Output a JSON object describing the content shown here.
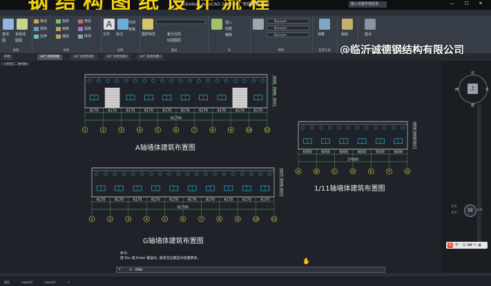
{
  "banner": {
    "title": "钢结构图纸设计流程",
    "window_title": "Autodesk AutoCAD 2022  34厂房结构图.dwg",
    "signin_placeholder": "键入关键字或短语",
    "window_buttons": "— ☐ ✕"
  },
  "watermark": "@临沂诚德钢结构有限公司",
  "ribbon_tabs": [
    "默认",
    "插入",
    "注释",
    "参数化",
    "视图",
    "管理",
    "输出",
    "附加模块",
    "协作",
    "Express Tools",
    "精选应用"
  ],
  "ribbon": {
    "panels": [
      {
        "label": "绘图",
        "tools": [
          "直线",
          "多段线",
          "圆",
          "圆弧"
        ]
      },
      {
        "label": "修改",
        "tools": [
          "移动",
          "旋转",
          "修剪",
          "复制",
          "镜像",
          "圆角",
          "拉伸",
          "缩放",
          "阵列"
        ]
      },
      {
        "label": "注释",
        "tools": [
          "文字",
          "标注",
          "引线",
          "表格"
        ]
      },
      {
        "label": "图层",
        "tools": [
          "图层特性",
          "置为当前",
          "匹配图层"
        ]
      },
      {
        "label": "块",
        "tools": [
          "插入",
          "创建",
          "编辑"
        ]
      },
      {
        "label": "特性",
        "tools": [
          "ByLayer",
          "ByLayer",
          "ByLayer"
        ]
      },
      {
        "label": "实用工具",
        "tools": [
          "测量"
        ]
      },
      {
        "label": "剪贴板",
        "tools": [
          "粘贴"
        ]
      },
      {
        "label": "视图",
        "tools": [
          "基点"
        ]
      }
    ]
  },
  "file_tabs": [
    "开始",
    "34厂房结构图",
    "34厂房结构图1",
    "34厂房结构图2",
    "34厂房结构图3"
  ],
  "viewport_label": "[-][俯视][二维线框]",
  "viewcube": {
    "north": "北",
    "south": "南",
    "east": "东",
    "west": "西",
    "face": "上"
  },
  "nav": {
    "zoom": "32",
    "labels": [
      "6.5",
      "8.5",
      "2.9"
    ]
  },
  "drawings": {
    "a_axis": {
      "title": "A轴墙体建筑布置图",
      "spans": [
        "6170",
        "6170",
        "6170",
        "6170",
        "6170",
        "6170",
        "6170",
        "6170",
        "6170",
        "6170"
      ],
      "total": "61700",
      "axes": [
        "1",
        "2",
        "3",
        "4",
        "5",
        "6",
        "7",
        "8",
        "9",
        "10",
        "11"
      ],
      "height_dims": [
        "3000",
        "9000",
        "1200"
      ]
    },
    "g_axis": {
      "title": "G轴墙体建筑布置图",
      "spans": [
        "6170",
        "6170",
        "6170",
        "6170",
        "6170",
        "6170",
        "6170",
        "6170",
        "6170",
        "6170"
      ],
      "total": "61700",
      "axes": [
        "1",
        "2",
        "3",
        "4",
        "5",
        "6",
        "7",
        "8",
        "9",
        "10",
        "11"
      ],
      "height_dims": [
        "1200",
        "9000",
        "1200"
      ]
    },
    "axis_1_11": {
      "title": "1/11轴墙体建筑布置图",
      "spans": [
        "6000",
        "6000",
        "6000",
        "6000",
        "6000",
        "6000"
      ],
      "total": "37000",
      "axes": [
        "A",
        "B",
        "C",
        "D",
        "E",
        "F",
        "G"
      ],
      "height_dims": [
        "3000",
        "9000",
        "1200"
      ]
    }
  },
  "command": {
    "history": [
      "命令:",
      "按 Esc 或 Enter 键退出, 或单击右键显示快捷菜单。"
    ],
    "prompt": "✎ - PAN"
  },
  "layout_tabs": [
    "模型",
    "Layout1",
    "Layout2",
    "+"
  ],
  "colors": {
    "background": "#1f2329",
    "title_yellow": "#f5d20a",
    "cad_white": "#e8e8e8",
    "cad_cyan": "#35c6e8",
    "cad_green": "#6fe07a",
    "cad_yellow": "#e8e24a"
  }
}
